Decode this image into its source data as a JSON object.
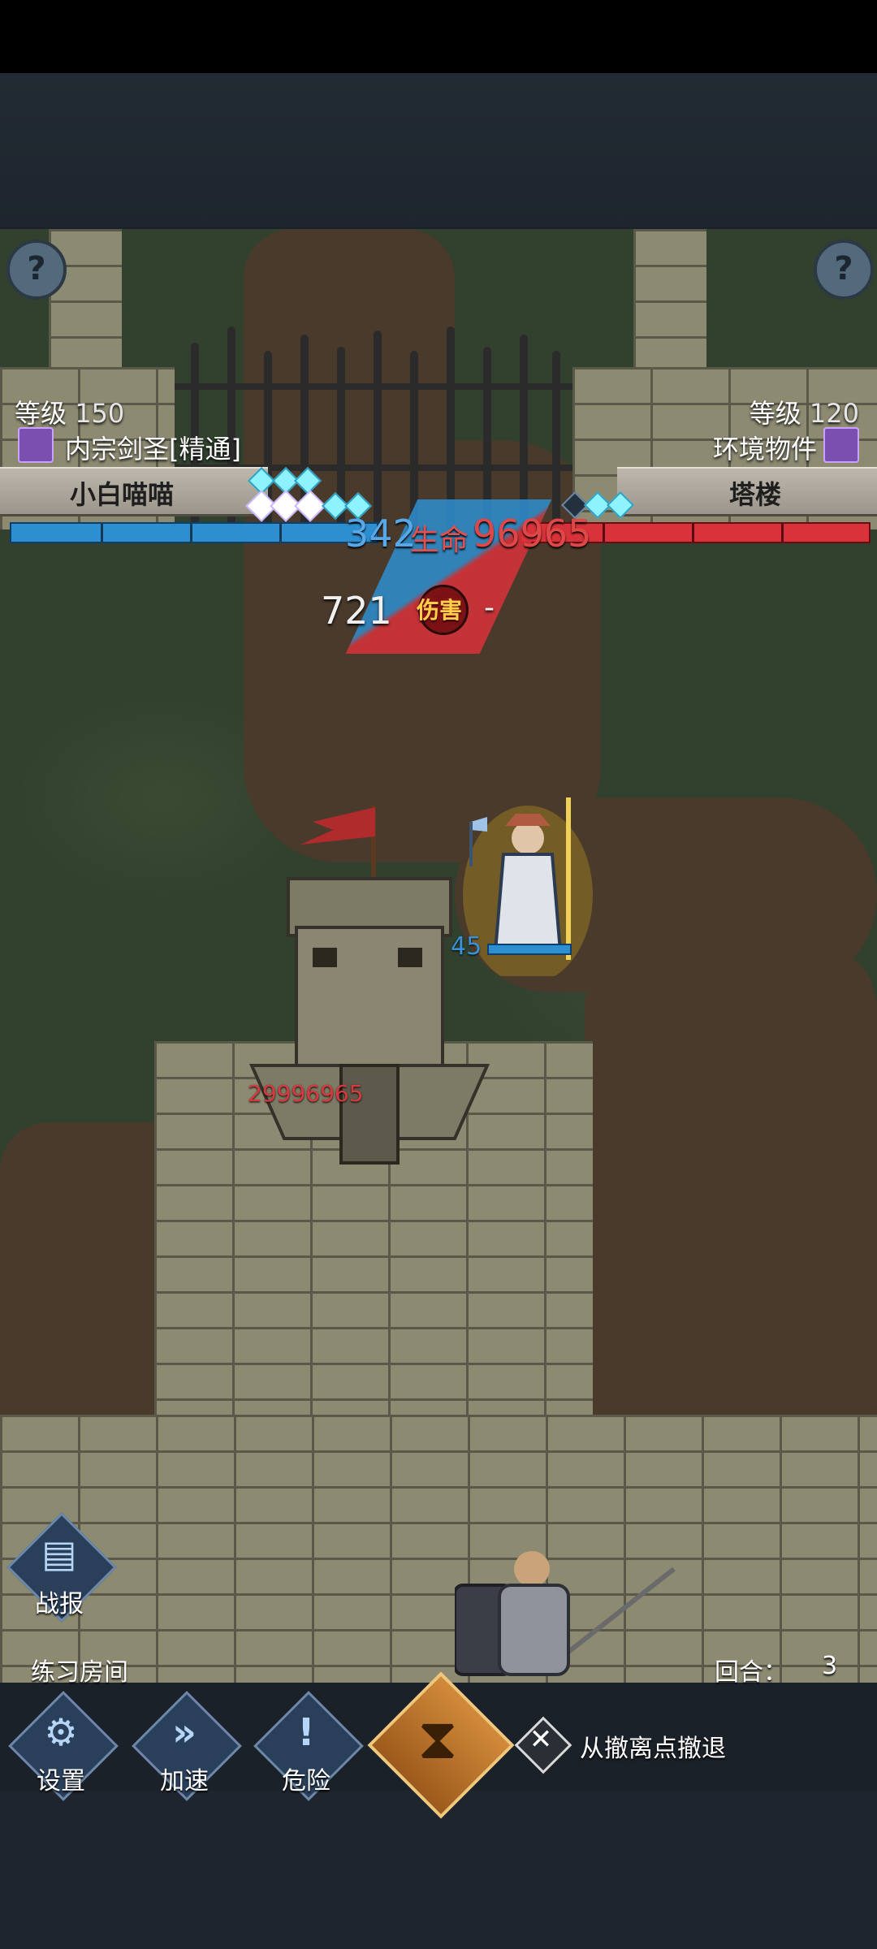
{
  "hud": {
    "left": {
      "level_label": "等级",
      "level_value": "150",
      "class_name": "内宗剑圣[精通]",
      "player_name": "小白喵喵"
    },
    "right": {
      "level_label": "等级",
      "level_value": "120",
      "class_name": "环境物件",
      "player_name": "塔楼"
    },
    "help_icon": "?"
  },
  "combat": {
    "blue_value": "342",
    "life_label": "生命",
    "red_value": "96965",
    "damage_value": "721",
    "damage_label": "伤害",
    "damage_right": "-",
    "tower_hp": "29996965",
    "hero_hp": "45"
  },
  "bottom": {
    "battle_report": "战报",
    "room_name": "练习房间",
    "round_label": "回合：",
    "round_value": "3",
    "settings": "设置",
    "speed": "加速",
    "danger": "危险",
    "retreat": "从撤离点撤退"
  },
  "colors": {
    "accent_gold": "#f0c67a",
    "hp_blue": "#2d8fd0",
    "hp_red": "#d8323a"
  },
  "icons": [
    "help-icon",
    "skill-icon",
    "battle-report-icon",
    "gear-icon",
    "fast-forward-icon",
    "exclamation-icon",
    "hourglass-icon",
    "crossed-tools-icon"
  ]
}
